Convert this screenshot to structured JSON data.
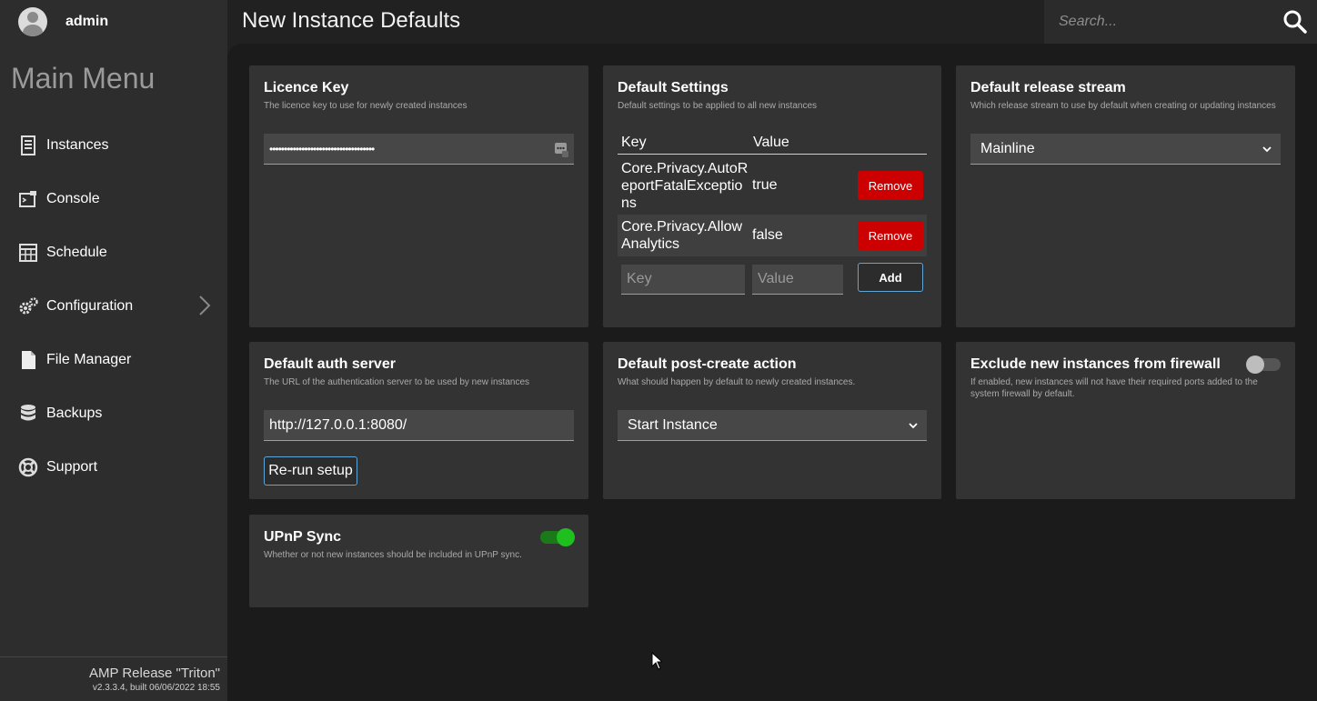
{
  "user": {
    "name": "admin"
  },
  "menu": {
    "title": "Main Menu",
    "items": [
      {
        "label": "Instances",
        "icon": "instances-icon"
      },
      {
        "label": "Console",
        "icon": "console-icon"
      },
      {
        "label": "Schedule",
        "icon": "schedule-icon"
      },
      {
        "label": "Configuration",
        "icon": "gears-icon"
      },
      {
        "label": "File Manager",
        "icon": "file-icon"
      },
      {
        "label": "Backups",
        "icon": "database-icon"
      },
      {
        "label": "Support",
        "icon": "lifebuoy-icon"
      }
    ]
  },
  "footer": {
    "release": "AMP Release \"Triton\"",
    "build": "v2.3.3.4, built 06/06/2022 18:55"
  },
  "header": {
    "title": "New Instance Defaults",
    "search_placeholder": "Search..."
  },
  "cards": {
    "licence": {
      "title": "Licence Key",
      "subtitle": "The licence key to use for newly created instances",
      "value": "••••••••••••••••••••••••••••••••••••"
    },
    "default_settings": {
      "title": "Default Settings",
      "subtitle": "Default settings to be applied to all new instances",
      "col_key": "Key",
      "col_value": "Value",
      "rows": [
        {
          "key": "Core.Privacy.AutoReportFatalExceptions",
          "value": "true",
          "action": "Remove"
        },
        {
          "key": "Core.Privacy.AllowAnalytics",
          "value": "false",
          "action": "Remove"
        }
      ],
      "key_placeholder": "Key",
      "value_placeholder": "Value",
      "add_label": "Add"
    },
    "release_stream": {
      "title": "Default release stream",
      "subtitle": "Which release stream to use by default when creating or updating instances",
      "selected": "Mainline"
    },
    "auth_server": {
      "title": "Default auth server",
      "subtitle": "The URL of the authentication server to be used by new instances",
      "value": "http://127.0.0.1:8080/",
      "button": "Re-run setup"
    },
    "post_create": {
      "title": "Default post-create action",
      "subtitle": "What should happen by default to newly created instances.",
      "selected": "Start Instance"
    },
    "firewall": {
      "title": "Exclude new instances from firewall",
      "subtitle": "If enabled, new instances will not have their required ports added to the system firewall by default.",
      "enabled": false
    },
    "upnp": {
      "title": "UPnP Sync",
      "subtitle": "Whether or not new instances should be included in UPnP sync.",
      "enabled": true
    }
  },
  "colors": {
    "accent_border": "#5fa6d6",
    "danger": "#cc0000",
    "toggle_on": "#1fbf1f"
  }
}
